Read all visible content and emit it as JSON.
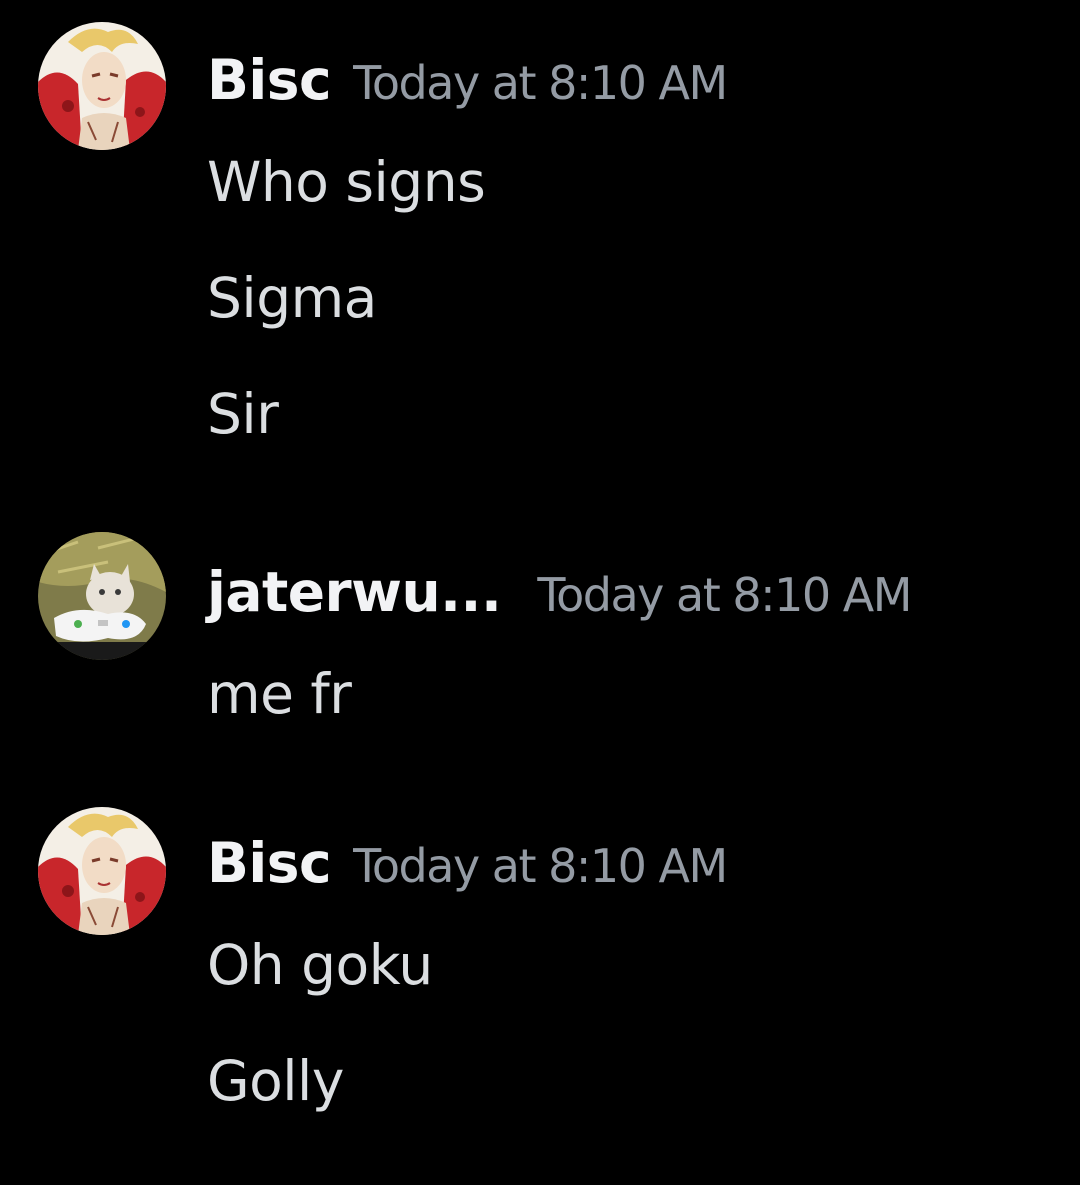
{
  "messages": [
    {
      "author": "Bisc",
      "timestamp": "Today at 8:10 AM",
      "avatar_icon": "anime-character-avatar-icon",
      "lines": [
        "Who signs",
        "Sigma",
        "Sir"
      ]
    },
    {
      "author": "jaterwu...",
      "timestamp": "Today at 8:10 AM",
      "avatar_icon": "kitten-with-controller-avatar-icon",
      "lines": [
        "me fr"
      ]
    },
    {
      "author": "Bisc",
      "timestamp": "Today at 8:10 AM",
      "avatar_icon": "anime-character-avatar-icon",
      "lines": [
        "Oh goku",
        "Golly"
      ]
    }
  ],
  "colors": {
    "background": "#000000",
    "username": "#f2f3f5",
    "timestamp": "#949ba4",
    "message_text": "#dbdee1"
  }
}
